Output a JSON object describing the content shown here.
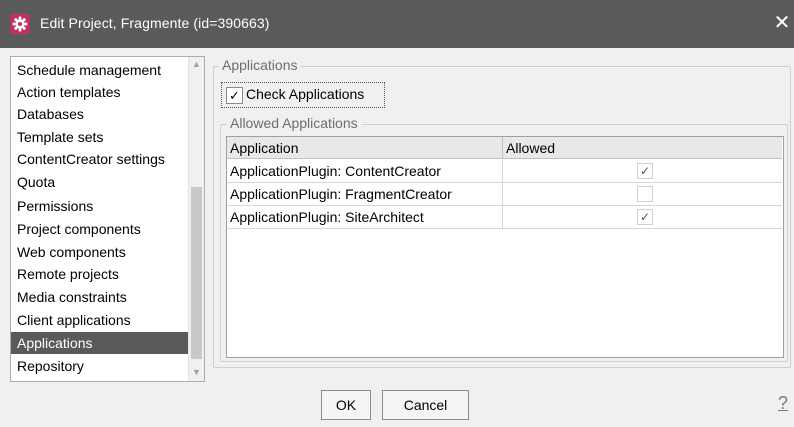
{
  "window": {
    "title": "Edit Project, Fragmente (id=390663)",
    "close_glyph": "✕",
    "icon": "gear-icon",
    "icon_color": "#c03060"
  },
  "nav": {
    "items": [
      {
        "label": "Schedule management"
      },
      {
        "label": "Action templates"
      },
      {
        "label": "Databases"
      },
      {
        "label": "Template sets"
      },
      {
        "label": "ContentCreator settings"
      },
      {
        "label": "Quota"
      },
      {
        "label": "Permissions"
      },
      {
        "label": "Project components"
      },
      {
        "label": "Web components"
      },
      {
        "label": "Remote projects"
      },
      {
        "label": "Media constraints"
      },
      {
        "label": "Client applications"
      },
      {
        "label": "Applications",
        "selected": true
      },
      {
        "label": "Repository"
      }
    ],
    "scroll_up": "▲",
    "scroll_down": "▼"
  },
  "applications": {
    "group_title": "Applications",
    "check_label": "Check Applications",
    "check_mark": "✓",
    "checked": true,
    "allowed_group_title": "Allowed Applications",
    "table": {
      "columns": [
        "Application",
        "Allowed"
      ],
      "rows": [
        {
          "application": "ApplicationPlugin: ContentCreator",
          "allowed": true,
          "mark": "✓"
        },
        {
          "application": "ApplicationPlugin: FragmentCreator",
          "allowed": false,
          "mark": ""
        },
        {
          "application": "ApplicationPlugin: SiteArchitect",
          "allowed": true,
          "mark": "✓"
        }
      ]
    }
  },
  "buttons": {
    "ok": "OK",
    "cancel": "Cancel",
    "help": "?"
  },
  "colors": {
    "titlebar": "#5a5a5a",
    "selection": "#5a5a5a",
    "background": "#f0f0f0"
  }
}
